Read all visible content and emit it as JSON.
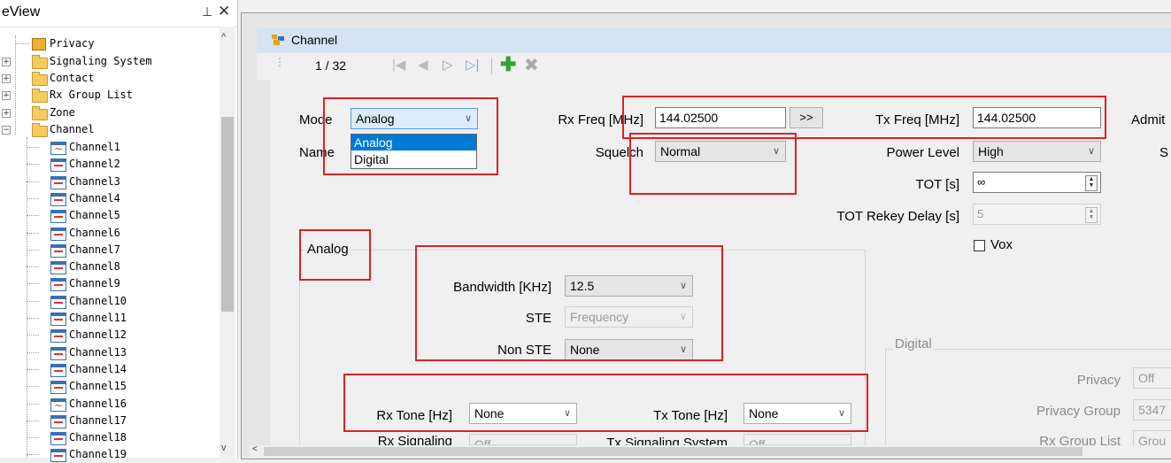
{
  "tree": {
    "title": "eView",
    "pin": "⊥",
    "close": "✕",
    "items": [
      {
        "label": "Privacy"
      },
      {
        "label": "Signaling System"
      },
      {
        "label": "Contact"
      },
      {
        "label": "Rx Group List"
      },
      {
        "label": "Zone"
      },
      {
        "label": "Channel"
      }
    ],
    "channels": [
      "Channel1",
      "Channel2",
      "Channel3",
      "Channel4",
      "Channel5",
      "Channel6",
      "Channel7",
      "Channel8",
      "Channel9",
      "Channel10",
      "Channel11",
      "Channel12",
      "Channel13",
      "Channel14",
      "Channel15",
      "Channel16",
      "Channel17",
      "Channel18",
      "Channel19"
    ]
  },
  "document": {
    "title": "Channel",
    "page_indicator": "1 / 32"
  },
  "form": {
    "mode": {
      "label": "Mode",
      "value": "Analog",
      "options": [
        "Analog",
        "Digital"
      ]
    },
    "name": {
      "label": "Name"
    },
    "rx_freq": {
      "label": "Rx Freq [MHz]",
      "value": "144.02500",
      "copy_button": ">>"
    },
    "tx_freq": {
      "label": "Tx Freq [MHz]",
      "value": "144.02500"
    },
    "admit": {
      "label": "Admit"
    },
    "squelch": {
      "label": "Squelch",
      "value": "Normal"
    },
    "power_level": {
      "label": "Power Level",
      "value": "High"
    },
    "s_label": "S",
    "tot": {
      "label": "TOT [s]",
      "value": "∞"
    },
    "tot_rekey": {
      "label": "TOT Rekey Delay [s]",
      "value": "5"
    },
    "vox": {
      "label": "Vox"
    }
  },
  "analog": {
    "legend": "Analog",
    "bandwidth": {
      "label": "Bandwidth [KHz]",
      "value": "12.5"
    },
    "ste": {
      "label": "STE",
      "value": "Frequency"
    },
    "non_ste": {
      "label": "Non STE",
      "value": "None"
    },
    "rx_tone": {
      "label": "Rx Tone [Hz]",
      "value": "None"
    },
    "tx_tone": {
      "label": "Tx Tone [Hz]",
      "value": "None"
    },
    "rx_signaling": {
      "label": "Rx Signaling",
      "value": "Off"
    },
    "tx_signaling": {
      "label": "Tx Signaling System",
      "value": "Off"
    }
  },
  "digital": {
    "legend": "Digital",
    "privacy": {
      "label": "Privacy",
      "value": "Off"
    },
    "privacy_group": {
      "label": "Privacy Group",
      "value": "5347"
    },
    "rx_group_list": {
      "label": "Rx Group List",
      "value": "Grou"
    }
  },
  "colors": {
    "highlight": "#e02020",
    "selection": "#0078d7",
    "header": "#d6e3f2"
  }
}
